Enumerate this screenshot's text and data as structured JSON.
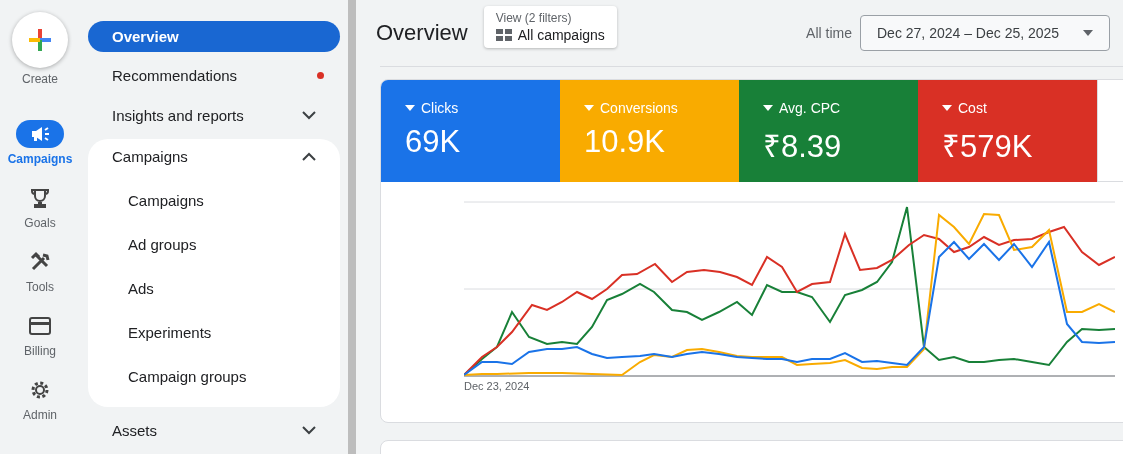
{
  "rail": {
    "create": {
      "label": "Create"
    },
    "items": [
      {
        "kind": "campaigns",
        "label": "Campaigns",
        "selected": true
      },
      {
        "kind": "goals",
        "label": "Goals",
        "selected": false
      },
      {
        "kind": "tools",
        "label": "Tools",
        "selected": false
      },
      {
        "kind": "billing",
        "label": "Billing",
        "selected": false
      },
      {
        "kind": "admin",
        "label": "Admin",
        "selected": false
      }
    ]
  },
  "nav": [
    {
      "label": "Overview",
      "selected": true
    },
    {
      "label": "Recommendations",
      "selected": false,
      "notification": true
    },
    {
      "label": "Insights and reports",
      "selected": false,
      "expanded": false
    },
    {
      "label": "Campaigns",
      "selected": false,
      "expanded": true,
      "children": [
        {
          "label": "Campaigns",
          "selected": false
        },
        {
          "label": "Ad groups",
          "selected": false
        },
        {
          "label": "Ads",
          "selected": false
        },
        {
          "label": "Experiments",
          "selected": false
        },
        {
          "label": "Campaign groups",
          "selected": false
        }
      ]
    },
    {
      "label": "Assets",
      "selected": false,
      "expanded": false
    }
  ],
  "header": {
    "title": "Overview",
    "view": {
      "caption": "View (2 filters)",
      "value": "All campaigns"
    },
    "range_label": "All time",
    "date_range": "Dec 27, 2024 – Dec 25, 2025"
  },
  "metrics": [
    {
      "label": "Clicks",
      "value": "69K",
      "color": "#1a73e8"
    },
    {
      "label": "Conversions",
      "value": "10.9K",
      "color": "#f9ab00"
    },
    {
      "label": "Avg. CPC",
      "value": "₹8.39",
      "color": "#188038"
    },
    {
      "label": "Cost",
      "value": "₹579K",
      "color": "#d93025"
    }
  ],
  "chart": {
    "x_start_label": "Dec 23, 2024"
  }
}
